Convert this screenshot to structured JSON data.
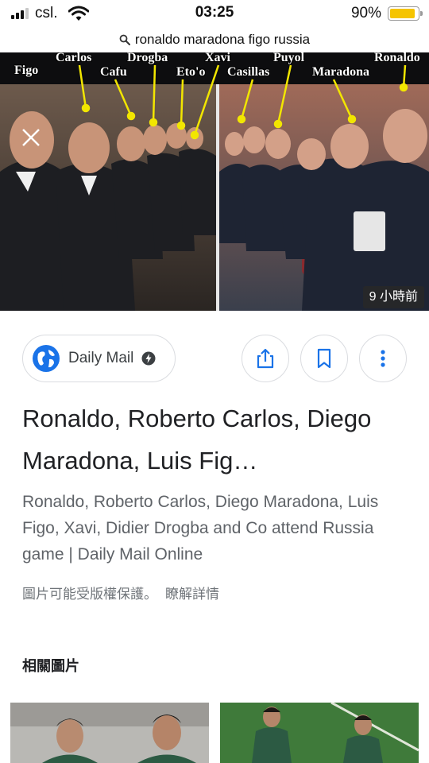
{
  "status_bar": {
    "carrier": "csl.",
    "time": "03:25",
    "battery": "90%",
    "battery_level": 0.9,
    "icons": [
      "signal-icon",
      "wifi-icon",
      "battery-icon"
    ]
  },
  "url_bar": {
    "query": "ronaldo maradona figo russia",
    "icon": "search-icon"
  },
  "image": {
    "labels": [
      "Figo",
      "Carlos",
      "Cafu",
      "Drogba",
      "Eto'o",
      "Xavi",
      "Casillas",
      "Puyol",
      "Maradona",
      "Ronaldo"
    ],
    "time_ago": "9 小時前",
    "close_icon": "close-icon",
    "label_color": "#f2e600"
  },
  "source": {
    "name": "Daily Mail",
    "icon": "globe-icon",
    "badge_icon": "amp-bolt-icon"
  },
  "actions": [
    "share-icon",
    "bookmark-icon",
    "more-vert-icon"
  ],
  "result": {
    "title": "Ronaldo, Roberto Carlos, Diego Maradona, Luis Fig…",
    "description": "Ronaldo, Roberto Carlos, Diego Maradona, Luis Figo, Xavi, Didier Drogba and Co attend Russia game | Daily Mail Online",
    "copyright_notice": "圖片可能受版權保護。",
    "learn_more": "瞭解詳情"
  },
  "related": {
    "heading": "相關圖片"
  },
  "colors": {
    "accent_blue": "#1a73e8",
    "text_primary": "#202124",
    "text_secondary": "#5f6368",
    "battery": "#f5c400"
  }
}
